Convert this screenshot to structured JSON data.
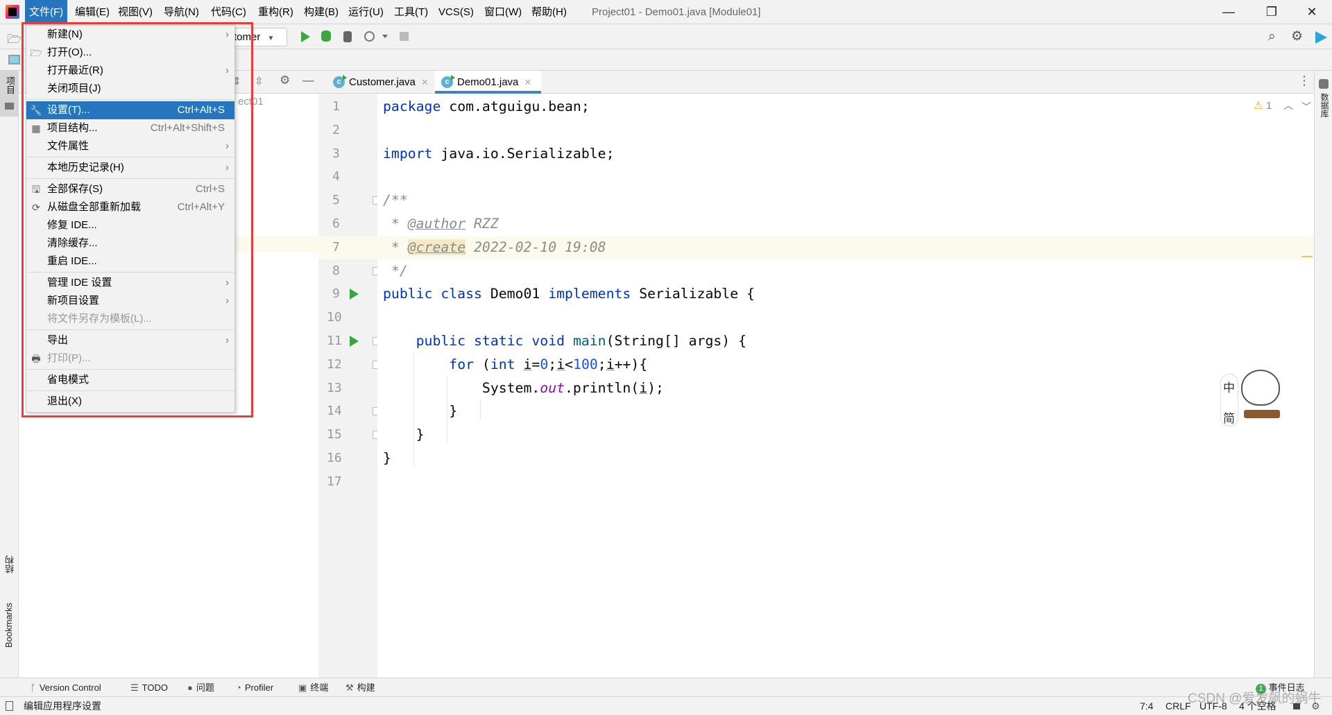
{
  "menubar": {
    "items": [
      "文件(F)",
      "编辑(E)",
      "视图(V)",
      "导航(N)",
      "代码(C)",
      "重构(R)",
      "构建(B)",
      "运行(U)",
      "工具(T)",
      "VCS(S)",
      "窗口(W)",
      "帮助(H)"
    ],
    "active_index": 0
  },
  "window": {
    "title": "Project01 - Demo01.java [Module01]",
    "minimize": "—",
    "restore": "❐",
    "close": "✕"
  },
  "toolbar": {
    "run_config": "tomer",
    "dropdown": "▼"
  },
  "project_panel": {
    "partial_text": "ect01"
  },
  "left_strip": {
    "project": "项目",
    "structure": "结构",
    "bookmarks": "Bookmarks"
  },
  "right_strip": {
    "database": "数据库"
  },
  "tabs": [
    {
      "label": "Customer.java",
      "selected": false
    },
    {
      "label": "Demo01.java",
      "selected": true
    }
  ],
  "editor": {
    "warning_count": "1",
    "highlighted_line": 7,
    "lines": [
      [
        {
          "t": "package",
          "c": "kw"
        },
        {
          "t": " com.atguigu.bean;"
        }
      ],
      [],
      [
        {
          "t": "import",
          "c": "kw"
        },
        {
          "t": " java.io.Serializable;"
        }
      ],
      [],
      [
        {
          "t": "/**",
          "c": "cm"
        }
      ],
      [
        {
          "t": " * ",
          "c": "cm"
        },
        {
          "t": "@author",
          "c": "tag"
        },
        {
          "t": " RZZ",
          "c": "cm"
        }
      ],
      [
        {
          "t": " * ",
          "c": "cm"
        },
        {
          "t": "@create",
          "c": "tagh"
        },
        {
          "t": " 2022-02-10 19:08",
          "c": "cm"
        }
      ],
      [
        {
          "t": " */",
          "c": "cm"
        }
      ],
      [
        {
          "t": "public class",
          "c": "kw"
        },
        {
          "t": " Demo01 "
        },
        {
          "t": "implements",
          "c": "kw"
        },
        {
          "t": " Serializable {"
        }
      ],
      [],
      [
        {
          "t": "    "
        },
        {
          "t": "public static void",
          "c": "kw"
        },
        {
          "t": " "
        },
        {
          "t": "main",
          "c": "mth"
        },
        {
          "t": "(String[] args) {"
        }
      ],
      [
        {
          "t": "        "
        },
        {
          "t": "for",
          "c": "kw"
        },
        {
          "t": " ("
        },
        {
          "t": "int",
          "c": "kw"
        },
        {
          "t": " "
        },
        {
          "t": "i",
          "c": "var"
        },
        {
          "t": "="
        },
        {
          "t": "0",
          "c": "num"
        },
        {
          "t": ";"
        },
        {
          "t": "i",
          "c": "var"
        },
        {
          "t": "<"
        },
        {
          "t": "100",
          "c": "num"
        },
        {
          "t": ";"
        },
        {
          "t": "i",
          "c": "var"
        },
        {
          "t": "++){"
        }
      ],
      [
        {
          "t": "            System."
        },
        {
          "t": "out",
          "c": "fld"
        },
        {
          "t": ".println("
        },
        {
          "t": "i",
          "c": "var"
        },
        {
          "t": ");"
        }
      ],
      [
        {
          "t": "        }"
        }
      ],
      [
        {
          "t": "    }"
        }
      ],
      [
        {
          "t": "}"
        }
      ],
      []
    ],
    "run_lines": [
      9,
      11
    ]
  },
  "file_menu": {
    "groups": [
      [
        {
          "label": "新建(N)",
          "submenu": true
        },
        {
          "label": "打开(O)...",
          "icon": "folder-icon"
        },
        {
          "label": "打开最近(R)",
          "submenu": true
        },
        {
          "label": "关闭项目(J)"
        }
      ],
      [
        {
          "label": "设置(T)...",
          "shortcut": "Ctrl+Alt+S",
          "icon": "wrench-icon",
          "highlighted": true
        },
        {
          "label": "项目结构...",
          "shortcut": "Ctrl+Alt+Shift+S",
          "icon": "project-structure-icon"
        },
        {
          "label": "文件属性",
          "submenu": true
        }
      ],
      [
        {
          "label": "本地历史记录(H)",
          "submenu": true
        }
      ],
      [
        {
          "label": "全部保存(S)",
          "shortcut": "Ctrl+S",
          "icon": "save-icon"
        },
        {
          "label": "从磁盘全部重新加载",
          "shortcut": "Ctrl+Alt+Y",
          "icon": "reload-icon"
        },
        {
          "label": "修复 IDE..."
        },
        {
          "label": "清除缓存..."
        },
        {
          "label": "重启 IDE..."
        }
      ],
      [
        {
          "label": "管理 IDE 设置",
          "submenu": true
        },
        {
          "label": "新项目设置",
          "submenu": true
        },
        {
          "label": "将文件另存为模板(L)...",
          "disabled": true
        }
      ],
      [
        {
          "label": "导出",
          "submenu": true
        },
        {
          "label": "打印(P)...",
          "icon": "print-icon",
          "disabled": true
        }
      ],
      [
        {
          "label": "省电模式"
        }
      ],
      [
        {
          "label": "退出(X)"
        }
      ]
    ]
  },
  "ime_widget": {
    "mode": "中",
    "variant": "简"
  },
  "tool_windows": [
    {
      "label": "Version Control",
      "icon": "branch-icon"
    },
    {
      "label": "TODO",
      "icon": "list-icon"
    },
    {
      "label": "问题",
      "icon": "problems-icon"
    },
    {
      "label": "Profiler",
      "icon": "profiler-icon"
    },
    {
      "label": "终端",
      "icon": "terminal-icon"
    },
    {
      "label": "构建",
      "icon": "hammer-icon"
    }
  ],
  "event_log": {
    "count": "1",
    "label": "事件日志"
  },
  "status": {
    "message": "编辑应用程序设置",
    "position": "7:4",
    "line_ending": "CRLF",
    "encoding": "UTF-8",
    "indent": "4 个空格"
  },
  "watermark": "CSDN @爱发飙的蜗牛",
  "colors": {
    "accent": "#2675bf",
    "highlight_box": "#f03a3a",
    "keyword": "#0033b3",
    "run": "#3da53d"
  }
}
